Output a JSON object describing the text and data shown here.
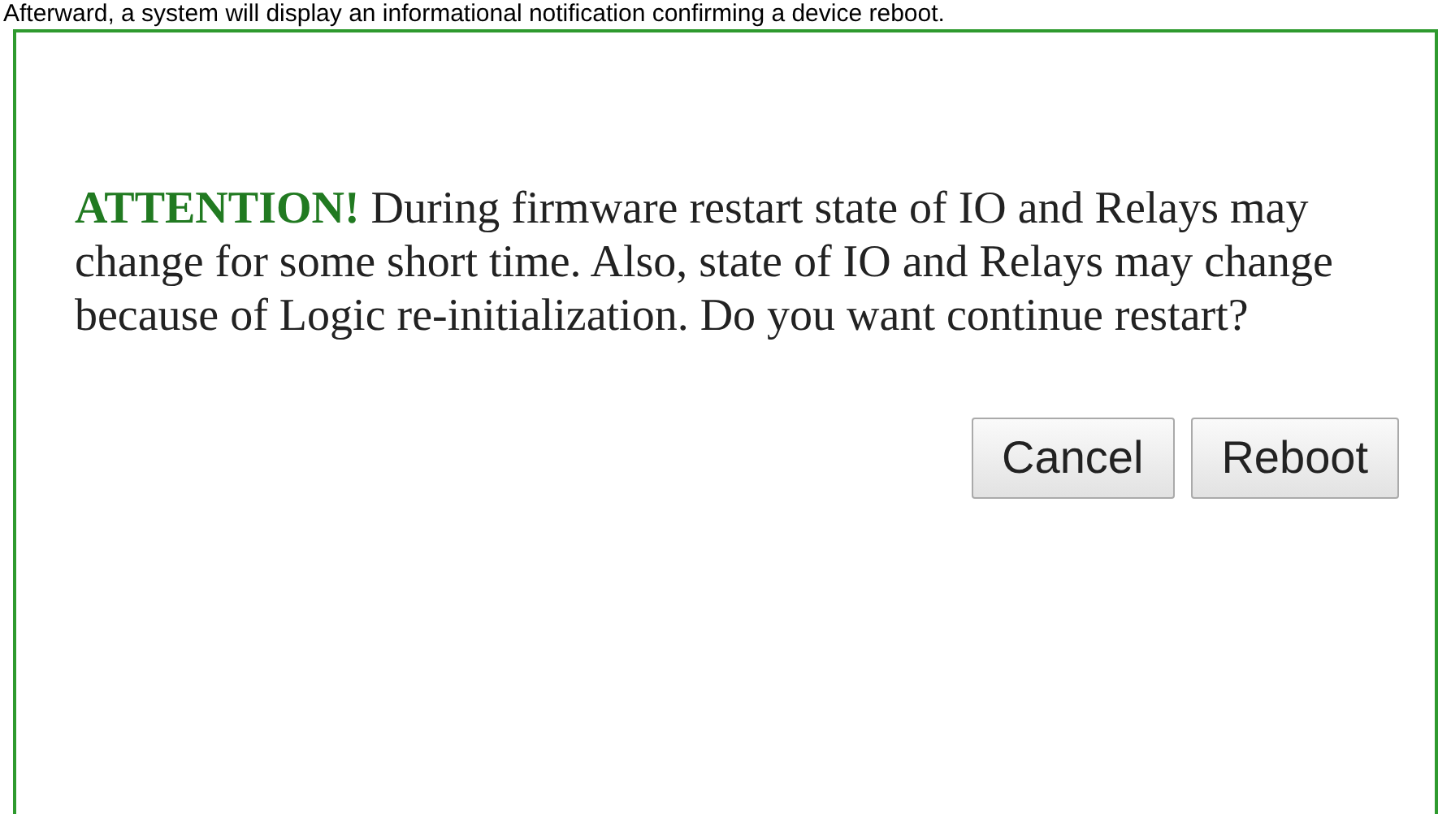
{
  "caption": "Afterward, a system will display an informational notification confirming a device reboot.",
  "dialog": {
    "message": "**ATTENTION!** During firmware restart state of IO and Relays may change for some short time. Also, state of IO and Relays may change because of Logic re-initialization. Do you want continue restart?",
    "buttons": [
      {
        "label": "Cancel"
      },
      {
        "label": "Reboot"
      }
    ]
  }
}
